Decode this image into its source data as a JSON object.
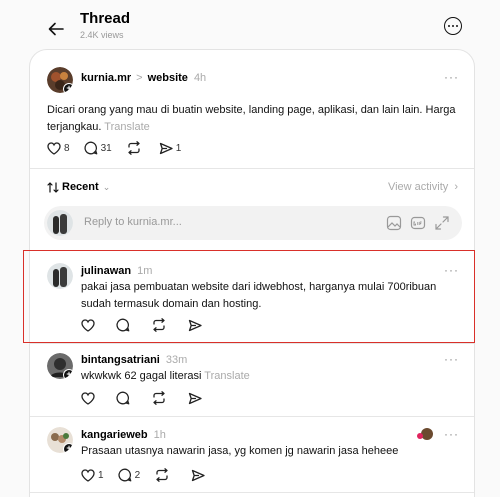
{
  "header": {
    "title": "Thread",
    "views": "2.4K views"
  },
  "root_post": {
    "username": "kurnia.mr",
    "separator": ">",
    "topic": "website",
    "time": "4h",
    "text": "Dicari orang yang mau di buatin website, landing page, aplikasi, dan lain lain. Harga terjangkau.",
    "translate": "Translate",
    "likes": "8",
    "replies": "31",
    "shares": "1"
  },
  "sort": {
    "label": "Recent",
    "view_activity": "View activity"
  },
  "reply_box": {
    "placeholder": "Reply to kurnia.mr..."
  },
  "replies": [
    {
      "username": "julinawan",
      "time": "1m",
      "text": "pakai jasa pembuatan website dari idwebhost, harganya mulai 700ribuan sudah termasuk domain dan hosting."
    },
    {
      "username": "bintangsatriani",
      "time": "33m",
      "text": "wkwkwk 62 gagal literasi",
      "translate": "Translate"
    },
    {
      "username": "kangarieweb",
      "time": "1h",
      "text": "Prasaan utasnya nawarin jasa, yg komen jg nawarin jasa heheee",
      "likes": "1",
      "replies": "2"
    }
  ],
  "colors": {
    "highlight": "#d9302a",
    "muted": "#aaaaaa"
  }
}
